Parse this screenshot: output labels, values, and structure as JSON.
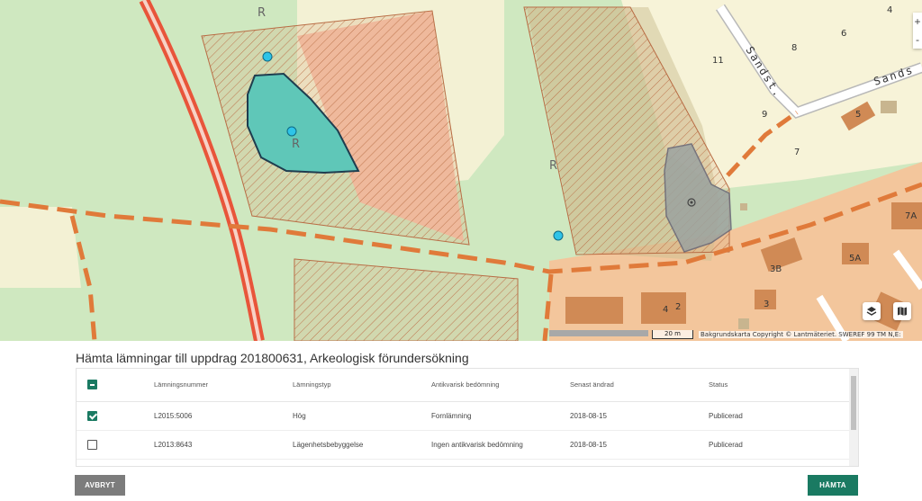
{
  "map": {
    "road_name": "Sandst.",
    "road_name_2": "Sands",
    "plot_numbers": [
      "4",
      "6",
      "8",
      "11",
      "9",
      "7",
      "5",
      "7A",
      "5A",
      "3B",
      "3",
      "4",
      "2"
    ],
    "rune_marks": [
      "R",
      "R",
      "R"
    ],
    "scale_label": "20 m",
    "attribution": "Bakgrundskarta Copyright © Lantmäteriet. SWEREF 99 TM N,E:",
    "zoom_in": "+",
    "zoom_out": "-"
  },
  "panel": {
    "title": "Hämta lämningar till uppdrag 201800631, Arkeologisk förundersökning"
  },
  "table": {
    "headers": [
      "Lämningsnummer",
      "Lämningstyp",
      "Antikvarisk bedömning",
      "Senast ändrad",
      "Status"
    ],
    "select_all_state": "partial",
    "rows": [
      {
        "checked": true,
        "nummer": "L2015:5006",
        "typ": "Hög",
        "bedomning": "Fornlämning",
        "andrad": "2018-08-15",
        "status": "Publicerad"
      },
      {
        "checked": false,
        "nummer": "L2013:8643",
        "typ": "Lägenhetsbebyggelse",
        "bedomning": "Ingen antikvarisk bedömning",
        "andrad": "2018-08-15",
        "status": "Publicerad"
      }
    ]
  },
  "buttons": {
    "cancel": "AVBRYT",
    "fetch": "HÄMTA"
  },
  "colors": {
    "accent": "#1a7a62",
    "cancel": "#7c7c7c"
  }
}
